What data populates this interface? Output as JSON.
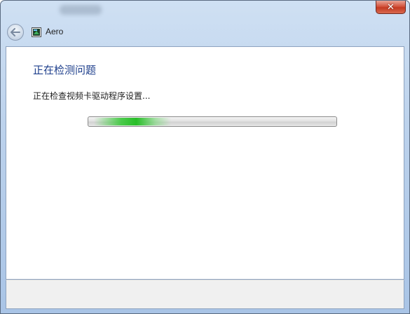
{
  "window": {
    "title": "",
    "close_label": "✕"
  },
  "navbar": {
    "back_icon": "back-arrow-icon",
    "app_icon": "aero-display-icon",
    "title": "Aero"
  },
  "main": {
    "heading": "正在检测问题",
    "status": "正在检查视频卡驱动程序设置...",
    "progress": {
      "indeterminate": true,
      "accent_color": "#2fbf2f"
    }
  },
  "colors": {
    "heading": "#1e3f8c",
    "close_button": "#c43a22"
  }
}
